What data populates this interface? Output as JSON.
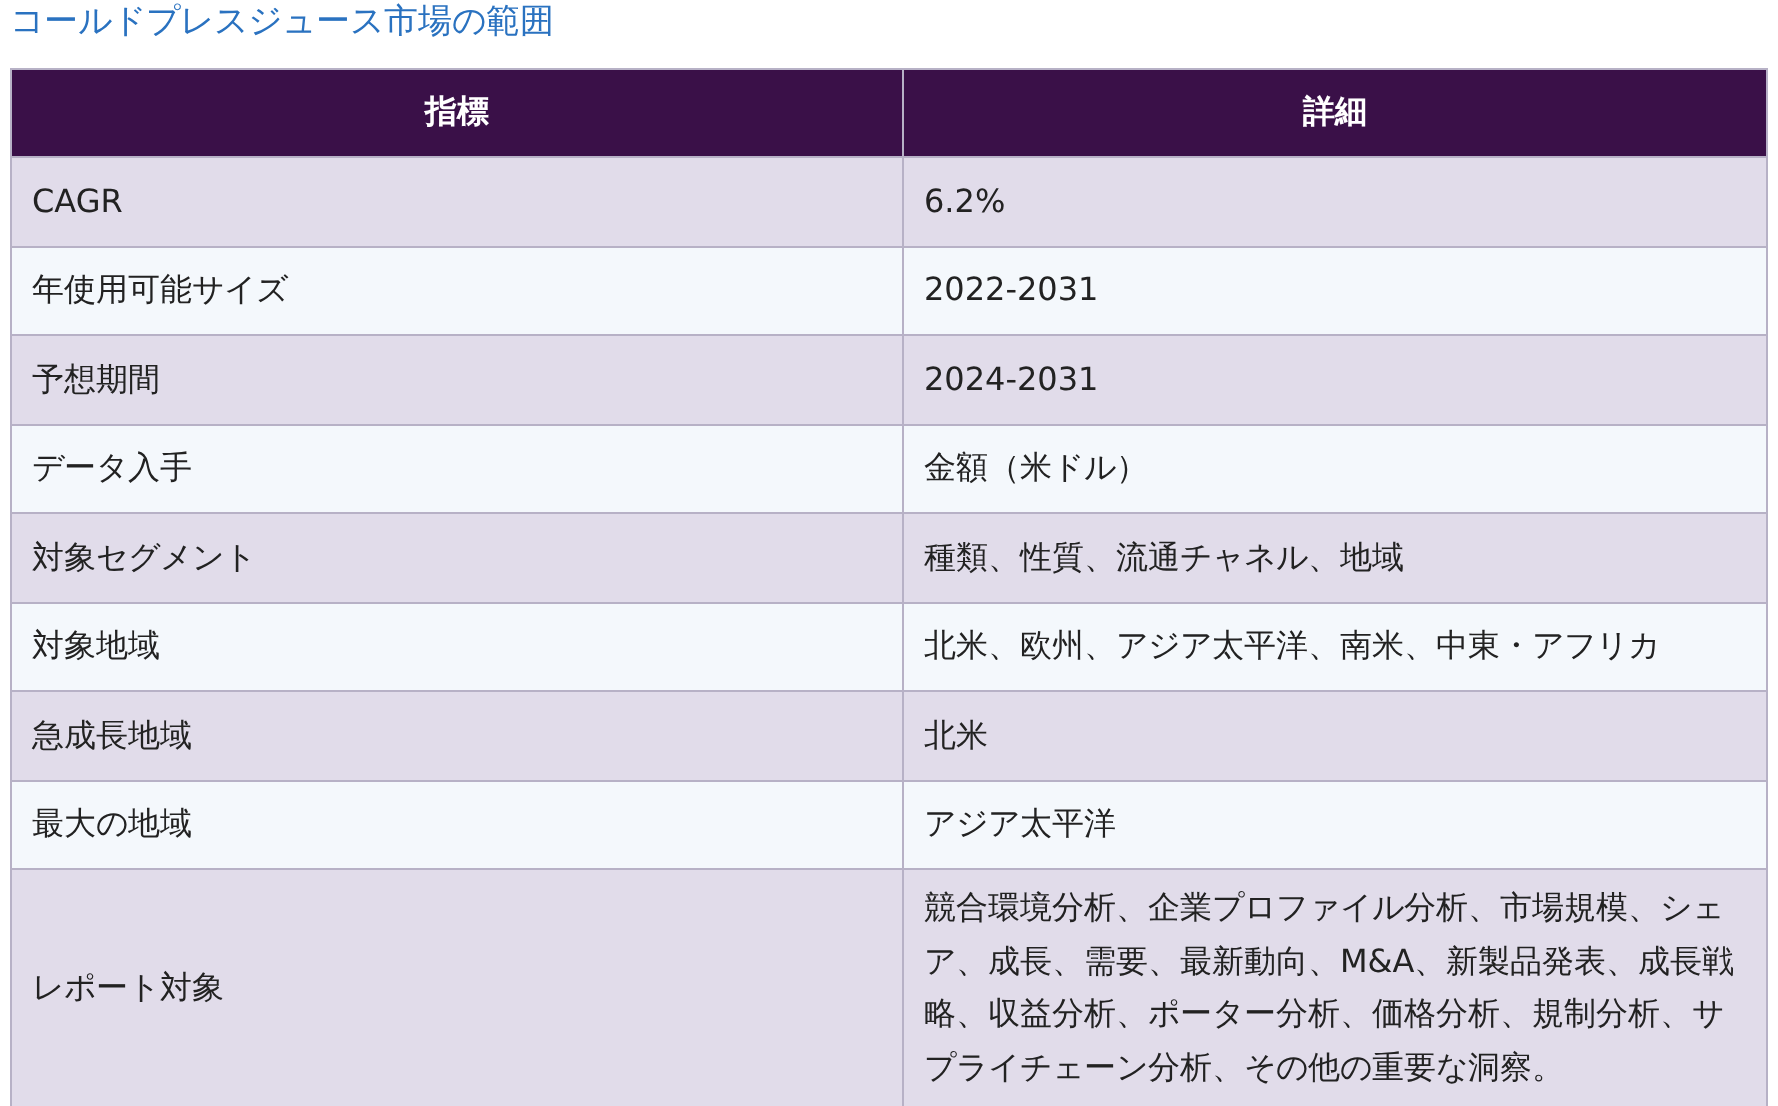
{
  "title": "コールドプレスジュース市場の範囲",
  "table": {
    "columns": [
      "指標",
      "詳細"
    ],
    "rows": [
      {
        "cells": [
          "CAGR",
          "6.2%"
        ]
      },
      {
        "cells": [
          "年使用可能サイズ",
          "2022-2031"
        ]
      },
      {
        "cells": [
          "予想期間",
          "2024-2031"
        ]
      },
      {
        "cells": [
          "データ入手",
          "金額（米ドル）"
        ]
      },
      {
        "cells": [
          "対象セグメント",
          "種類、性質、流通チャネル、地域"
        ]
      },
      {
        "cells": [
          "対象地域",
          "北米、欧州、アジア太平洋、南米、中東・アフリカ"
        ]
      },
      {
        "cells": [
          "急成長地域",
          "北米"
        ]
      },
      {
        "cells": [
          "最大の地域",
          "アジア太平洋"
        ]
      },
      {
        "cells": [
          "レポート対象",
          "競合環境分析、企業プロファイル分析、市場規模、シェア、成長、需要、最新動向、M&A、新製品発表、成長戦略、収益分析、ポーター分析、価格分析、規制分析、サプライチェーン分析、その他の重要な洞察。"
        ]
      }
    ]
  }
}
